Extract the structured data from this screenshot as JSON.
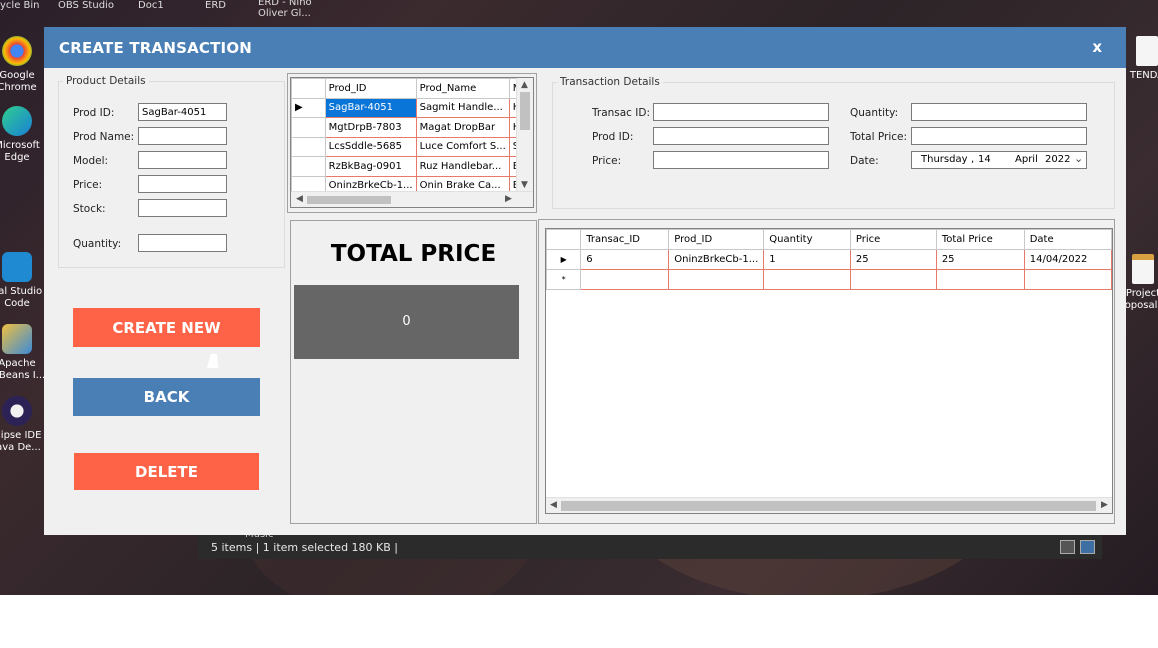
{
  "desktop": {
    "top_items": [
      "ycle Bin",
      "OBS Studio",
      "Doc1",
      "ERD",
      "ERD - Nino Oliver Gl..."
    ],
    "left_icons": [
      "Google Chrome",
      "Microsoft Edge",
      "ual Studio Code",
      "Apache etBeans I...",
      "clipse IDE Java De..."
    ],
    "right_icons": [
      "TENDA",
      "Project oposal("
    ]
  },
  "explorer": {
    "status": "5 items  |  1 item selected  180 KB  |",
    "partial_label": "Music"
  },
  "window": {
    "title": "CREATE TRANSACTION",
    "close_label": "x"
  },
  "product_details": {
    "legend": "Product Details",
    "prod_id_label": "Prod ID:",
    "prod_id_value": "SagBar-4051",
    "prod_name_label": "Prod Name:",
    "prod_name_value": "",
    "model_label": "Model:",
    "model_value": "",
    "price_label": "Price:",
    "price_value": "",
    "stock_label": "Stock:",
    "stock_value": "",
    "quantity_label": "Quantity:",
    "quantity_value": ""
  },
  "buttons": {
    "create_new": "CREATE NEW",
    "back": "BACK",
    "delete": "DELETE"
  },
  "colors": {
    "titlebar": "#4a7fb5",
    "create": "#ff6347",
    "back": "#4a7fb5",
    "delete": "#ff6347",
    "selected_row": "#0a75d8",
    "grid_border": "#e57a6a"
  },
  "product_grid": {
    "columns": [
      "Prod_ID",
      "Prod_Name",
      "M"
    ],
    "rows": [
      {
        "marker": "▶",
        "cells": [
          "SagBar-4051",
          "Sagmit Handle...",
          "Hc"
        ]
      },
      {
        "marker": "",
        "cells": [
          "MgtDrpB-7803",
          "Magat DropBar",
          "Hc"
        ]
      },
      {
        "marker": "",
        "cells": [
          "LcsSddle-5685",
          "Luce Comfort S...",
          "Sc"
        ]
      },
      {
        "marker": "",
        "cells": [
          "RzBkBag-0901",
          "Ruz Handlebar...",
          "Bc"
        ]
      },
      {
        "marker": "",
        "cells": [
          "OninzBrkeCb-1...",
          "Onin Brake Ca...",
          "Brc"
        ]
      }
    ]
  },
  "total": {
    "title": "TOTAL PRICE",
    "value": "0"
  },
  "transaction_details": {
    "legend": "Transaction Details",
    "transac_id_label": "Transac ID:",
    "transac_id_value": "",
    "prod_id_label": "Prod ID:",
    "prod_id_value": "",
    "price_label": "Price:",
    "price_value": "",
    "quantity_label": "Quantity:",
    "quantity_value": "",
    "total_price_label": "Total Price:",
    "total_price_value": "",
    "date_label": "Date:",
    "date_day": "Thursday",
    "date_sep": ",",
    "date_num": "14",
    "date_month": "April",
    "date_year": "2022"
  },
  "transaction_grid": {
    "columns": [
      "Transac_ID",
      "Prod_ID",
      "Quantity",
      "Price",
      "Total Price",
      "Date"
    ],
    "rows": [
      {
        "marker": "▶",
        "cells": [
          "6",
          "OninzBrkeCb-1...",
          "1",
          "25",
          "25",
          "14/04/2022"
        ]
      },
      {
        "marker": "*",
        "cells": [
          "",
          "",
          "",
          "",
          "",
          ""
        ]
      }
    ]
  }
}
